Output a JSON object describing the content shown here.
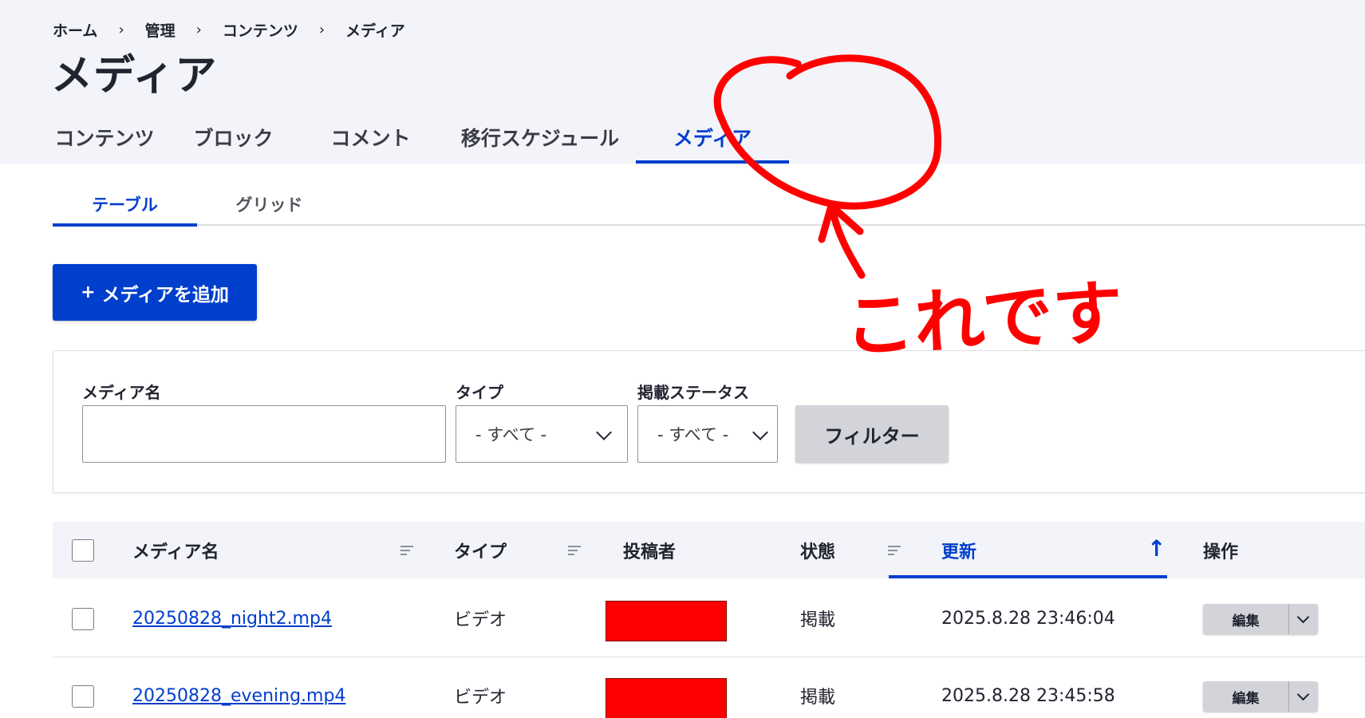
{
  "breadcrumb": [
    "ホーム",
    "管理",
    "コンテンツ",
    "メディア"
  ],
  "breadcrumb_separator": "›",
  "page_title": "メディア",
  "primary_tabs": [
    {
      "label": "コンテンツ",
      "active": false
    },
    {
      "label": "ブロック",
      "active": false
    },
    {
      "label": "コメント",
      "active": false
    },
    {
      "label": "移行スケジュール",
      "active": false
    },
    {
      "label": "メディア",
      "active": true
    }
  ],
  "secondary_tabs": [
    {
      "label": "テーブル",
      "active": true
    },
    {
      "label": "グリッド",
      "active": false
    }
  ],
  "add_button": {
    "plus": "+",
    "label": "メディアを追加"
  },
  "filters": {
    "name_label": "メディア名",
    "name_value": "",
    "type_label": "タイプ",
    "type_value": "- すべて -",
    "status_label": "掲載ステータス",
    "status_value": "- すべて -",
    "filter_button": "フィルター"
  },
  "table": {
    "columns": [
      "メディア名",
      "タイプ",
      "投稿者",
      "状態",
      "更新",
      "操作"
    ],
    "sorted_column": "更新",
    "sort_direction": "ascending",
    "rows": [
      {
        "name": "20250828_night2.mp4",
        "type": "ビデオ",
        "author": "",
        "status": "掲載",
        "updated": "2025.8.28 23:46:04",
        "op": "編集"
      },
      {
        "name": "20250828_evening.mp4",
        "type": "ビデオ",
        "author": "",
        "status": "掲載",
        "updated": "2025.8.28 23:45:58",
        "op": "編集"
      }
    ]
  },
  "annotation": {
    "text": "これです",
    "color": "#ff0000"
  },
  "colors": {
    "accent": "#003ecc",
    "header_bg": "#f3f4f9",
    "redaction": "#ff0000"
  }
}
